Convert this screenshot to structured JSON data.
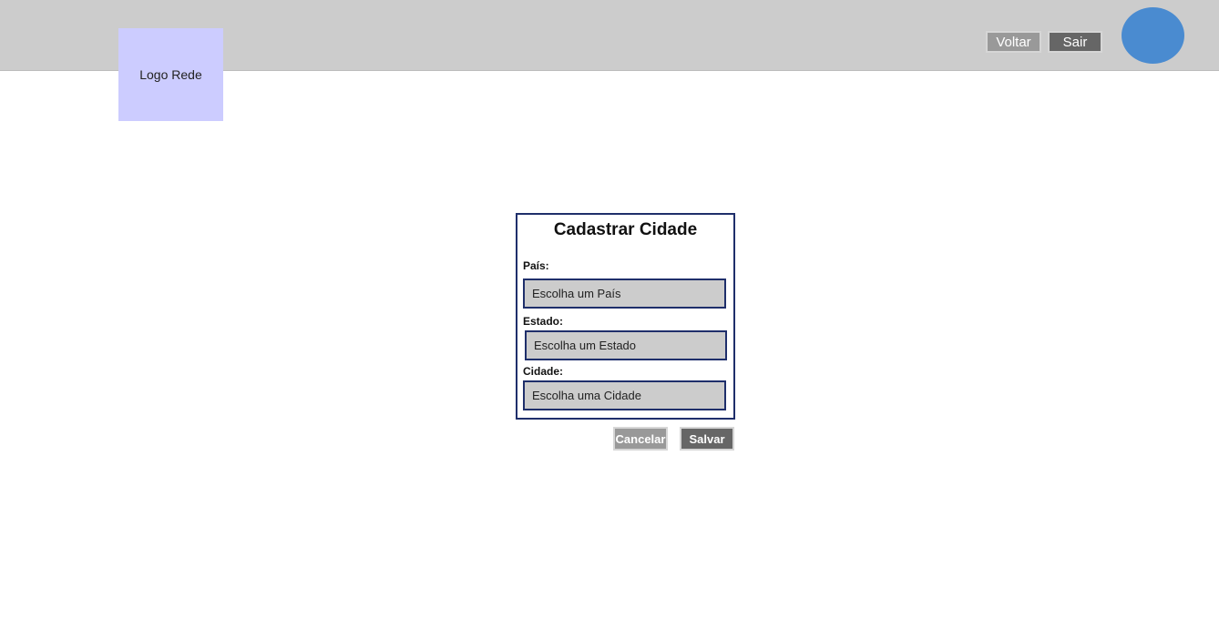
{
  "header": {
    "logo_text": "Logo Rede",
    "back_label": "Voltar",
    "exit_label": "Sair"
  },
  "form": {
    "title": "Cadastrar Cidade",
    "country": {
      "label": "País:",
      "placeholder": "Escolha um País"
    },
    "state": {
      "label": "Estado:",
      "placeholder": "Escolha um Estado"
    },
    "city": {
      "label": "Cidade:",
      "placeholder": "Escolha uma Cidade"
    },
    "cancel_label": "Cancelar",
    "save_label": "Salvar"
  },
  "colors": {
    "topbar": "#cccccc",
    "logo_bg": "#ccccff",
    "avatar": "#4a8bd0",
    "border_accent": "#1f2f6b",
    "secondary_button": "#999999",
    "primary_button": "#666666"
  }
}
